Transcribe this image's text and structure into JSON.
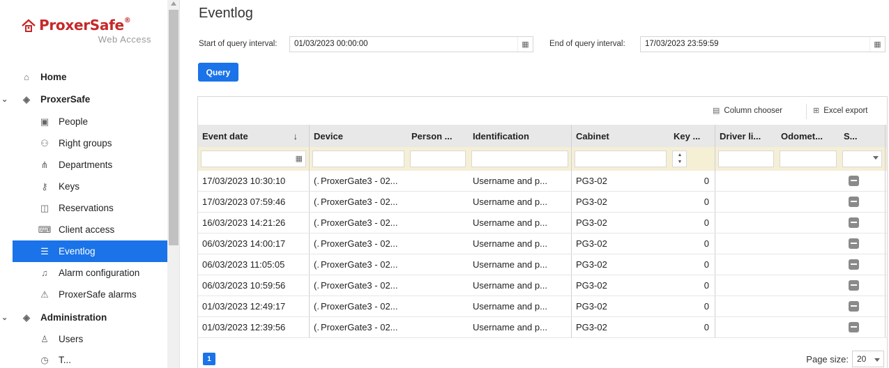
{
  "logo": {
    "brand": "ProxerSafe",
    "reg": "®",
    "sub": "Web Access"
  },
  "sidebar": {
    "items": [
      {
        "label": "Home",
        "icon": "home-icon",
        "glyph": "⌂",
        "level": "top"
      },
      {
        "label": "ProxerSafe",
        "icon": "layers-icon",
        "glyph": "◈",
        "level": "top",
        "expanded": true
      },
      {
        "label": "People",
        "icon": "id-card-icon",
        "glyph": "▣",
        "level": "sub"
      },
      {
        "label": "Right groups",
        "icon": "users-icon",
        "glyph": "⚇",
        "level": "sub"
      },
      {
        "label": "Departments",
        "icon": "org-chart-icon",
        "glyph": "⋔",
        "level": "sub"
      },
      {
        "label": "Keys",
        "icon": "key-icon",
        "glyph": "⚷",
        "level": "sub"
      },
      {
        "label": "Reservations",
        "icon": "book-icon",
        "glyph": "◫",
        "level": "sub"
      },
      {
        "label": "Client access",
        "icon": "keyboard-icon",
        "glyph": "⌨",
        "level": "sub"
      },
      {
        "label": "Eventlog",
        "icon": "list-icon",
        "glyph": "☰",
        "level": "sub",
        "active": true
      },
      {
        "label": "Alarm configuration",
        "icon": "bell-icon",
        "glyph": "♫",
        "level": "sub"
      },
      {
        "label": "ProxerSafe alarms",
        "icon": "warning-icon",
        "glyph": "⚠",
        "level": "sub"
      },
      {
        "label": "Administration",
        "icon": "layers-icon",
        "glyph": "◈",
        "level": "top",
        "expanded": true
      },
      {
        "label": "Users",
        "icon": "user-icon",
        "glyph": "♙",
        "level": "sub"
      },
      {
        "label": "T...",
        "icon": "clock-icon",
        "glyph": "◷",
        "level": "sub"
      }
    ]
  },
  "main": {
    "title": "Eventlog",
    "start_label": "Start of query interval:",
    "start_value": "01/03/2023 00:00:00",
    "end_label": "End of query interval:",
    "end_value": "17/03/2023 23:59:59",
    "query_label": "Query"
  },
  "grid": {
    "column_chooser": "Column chooser",
    "excel_export": "Excel export",
    "columns": [
      "Event date",
      "Device",
      "Person ...",
      "Identification",
      "Cabinet",
      "Key ...",
      "Driver li...",
      "Odomet...",
      "S..."
    ],
    "rows": [
      {
        "date": "17/03/2023 10:30:10",
        "prefix": "(.",
        "device": "ProxerGate3 - 02...",
        "person": "",
        "identification": "Username and p...",
        "cabinet": "PG3-02",
        "key": "0",
        "driver": "",
        "odometer": ""
      },
      {
        "date": "17/03/2023 07:59:46",
        "prefix": "(.",
        "device": "ProxerGate3 - 02...",
        "person": "",
        "identification": "Username and p...",
        "cabinet": "PG3-02",
        "key": "0",
        "driver": "",
        "odometer": ""
      },
      {
        "date": "16/03/2023 14:21:26",
        "prefix": "(.",
        "device": "ProxerGate3 - 02...",
        "person": "",
        "identification": "Username and p...",
        "cabinet": "PG3-02",
        "key": "0",
        "driver": "",
        "odometer": ""
      },
      {
        "date": "06/03/2023 14:00:17",
        "prefix": "(.",
        "device": "ProxerGate3 - 02...",
        "person": "",
        "identification": "Username and p...",
        "cabinet": "PG3-02",
        "key": "0",
        "driver": "",
        "odometer": ""
      },
      {
        "date": "06/03/2023 11:05:05",
        "prefix": "(.",
        "device": "ProxerGate3 - 02...",
        "person": "",
        "identification": "Username and p...",
        "cabinet": "PG3-02",
        "key": "0",
        "driver": "",
        "odometer": ""
      },
      {
        "date": "06/03/2023 10:59:56",
        "prefix": "(.",
        "device": "ProxerGate3 - 02...",
        "person": "",
        "identification": "Username and p...",
        "cabinet": "PG3-02",
        "key": "0",
        "driver": "",
        "odometer": ""
      },
      {
        "date": "01/03/2023 12:49:17",
        "prefix": "(.",
        "device": "ProxerGate3 - 02...",
        "person": "",
        "identification": "Username and p...",
        "cabinet": "PG3-02",
        "key": "0",
        "driver": "",
        "odometer": ""
      },
      {
        "date": "01/03/2023 12:39:56",
        "prefix": "(.",
        "device": "ProxerGate3 - 02...",
        "person": "",
        "identification": "Username and p...",
        "cabinet": "PG3-02",
        "key": "0",
        "driver": "",
        "odometer": ""
      }
    ],
    "page": "1",
    "page_size_label": "Page size:",
    "page_size": "20"
  },
  "colors": {
    "accent": "#1a73e8",
    "filter_bg": "#f5efd6",
    "header_bg": "#e8e8e8",
    "brand_red": "#c62828"
  }
}
